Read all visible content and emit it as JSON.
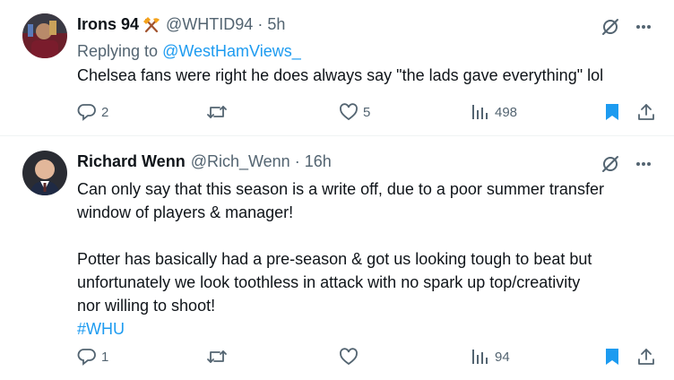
{
  "tweets": [
    {
      "name": "Irons 94",
      "name_emoji": "hammer-and-pick",
      "handle": "@WHTID94",
      "dot": "·",
      "time": "5h",
      "replying_prefix": "Replying to ",
      "replying_to": "@WestHamViews_",
      "text_lines": [
        "Chelsea fans were right he does always say \"the lads gave everything\" lol"
      ],
      "replies": "2",
      "retweets": "",
      "likes": "5",
      "views": "498",
      "bookmarked": true
    },
    {
      "name": "Richard Wenn",
      "handle": "@Rich_Wenn",
      "dot": "·",
      "time": "16h",
      "text_lines": [
        "Can only say that this season is a write off, due to a poor summer transfer",
        "window of players & manager!",
        "Potter has basically had a pre-season & got us looking tough to beat but",
        "unfortunately we look toothless in attack with no spark up top/creativity",
        "nor willing to shoot!"
      ],
      "hashtag": "#WHU",
      "replies": "1",
      "retweets": "",
      "likes": "",
      "views": "94",
      "bookmarked": true
    }
  ],
  "colors": {
    "link": "#1d9bf0",
    "muted": "#536471",
    "text": "#0f1419",
    "divider": "#eff3f4"
  },
  "icons": [
    "grok-icon",
    "more-icon",
    "reply-icon",
    "retweet-icon",
    "like-icon",
    "views-icon",
    "bookmark-icon",
    "share-icon"
  ]
}
